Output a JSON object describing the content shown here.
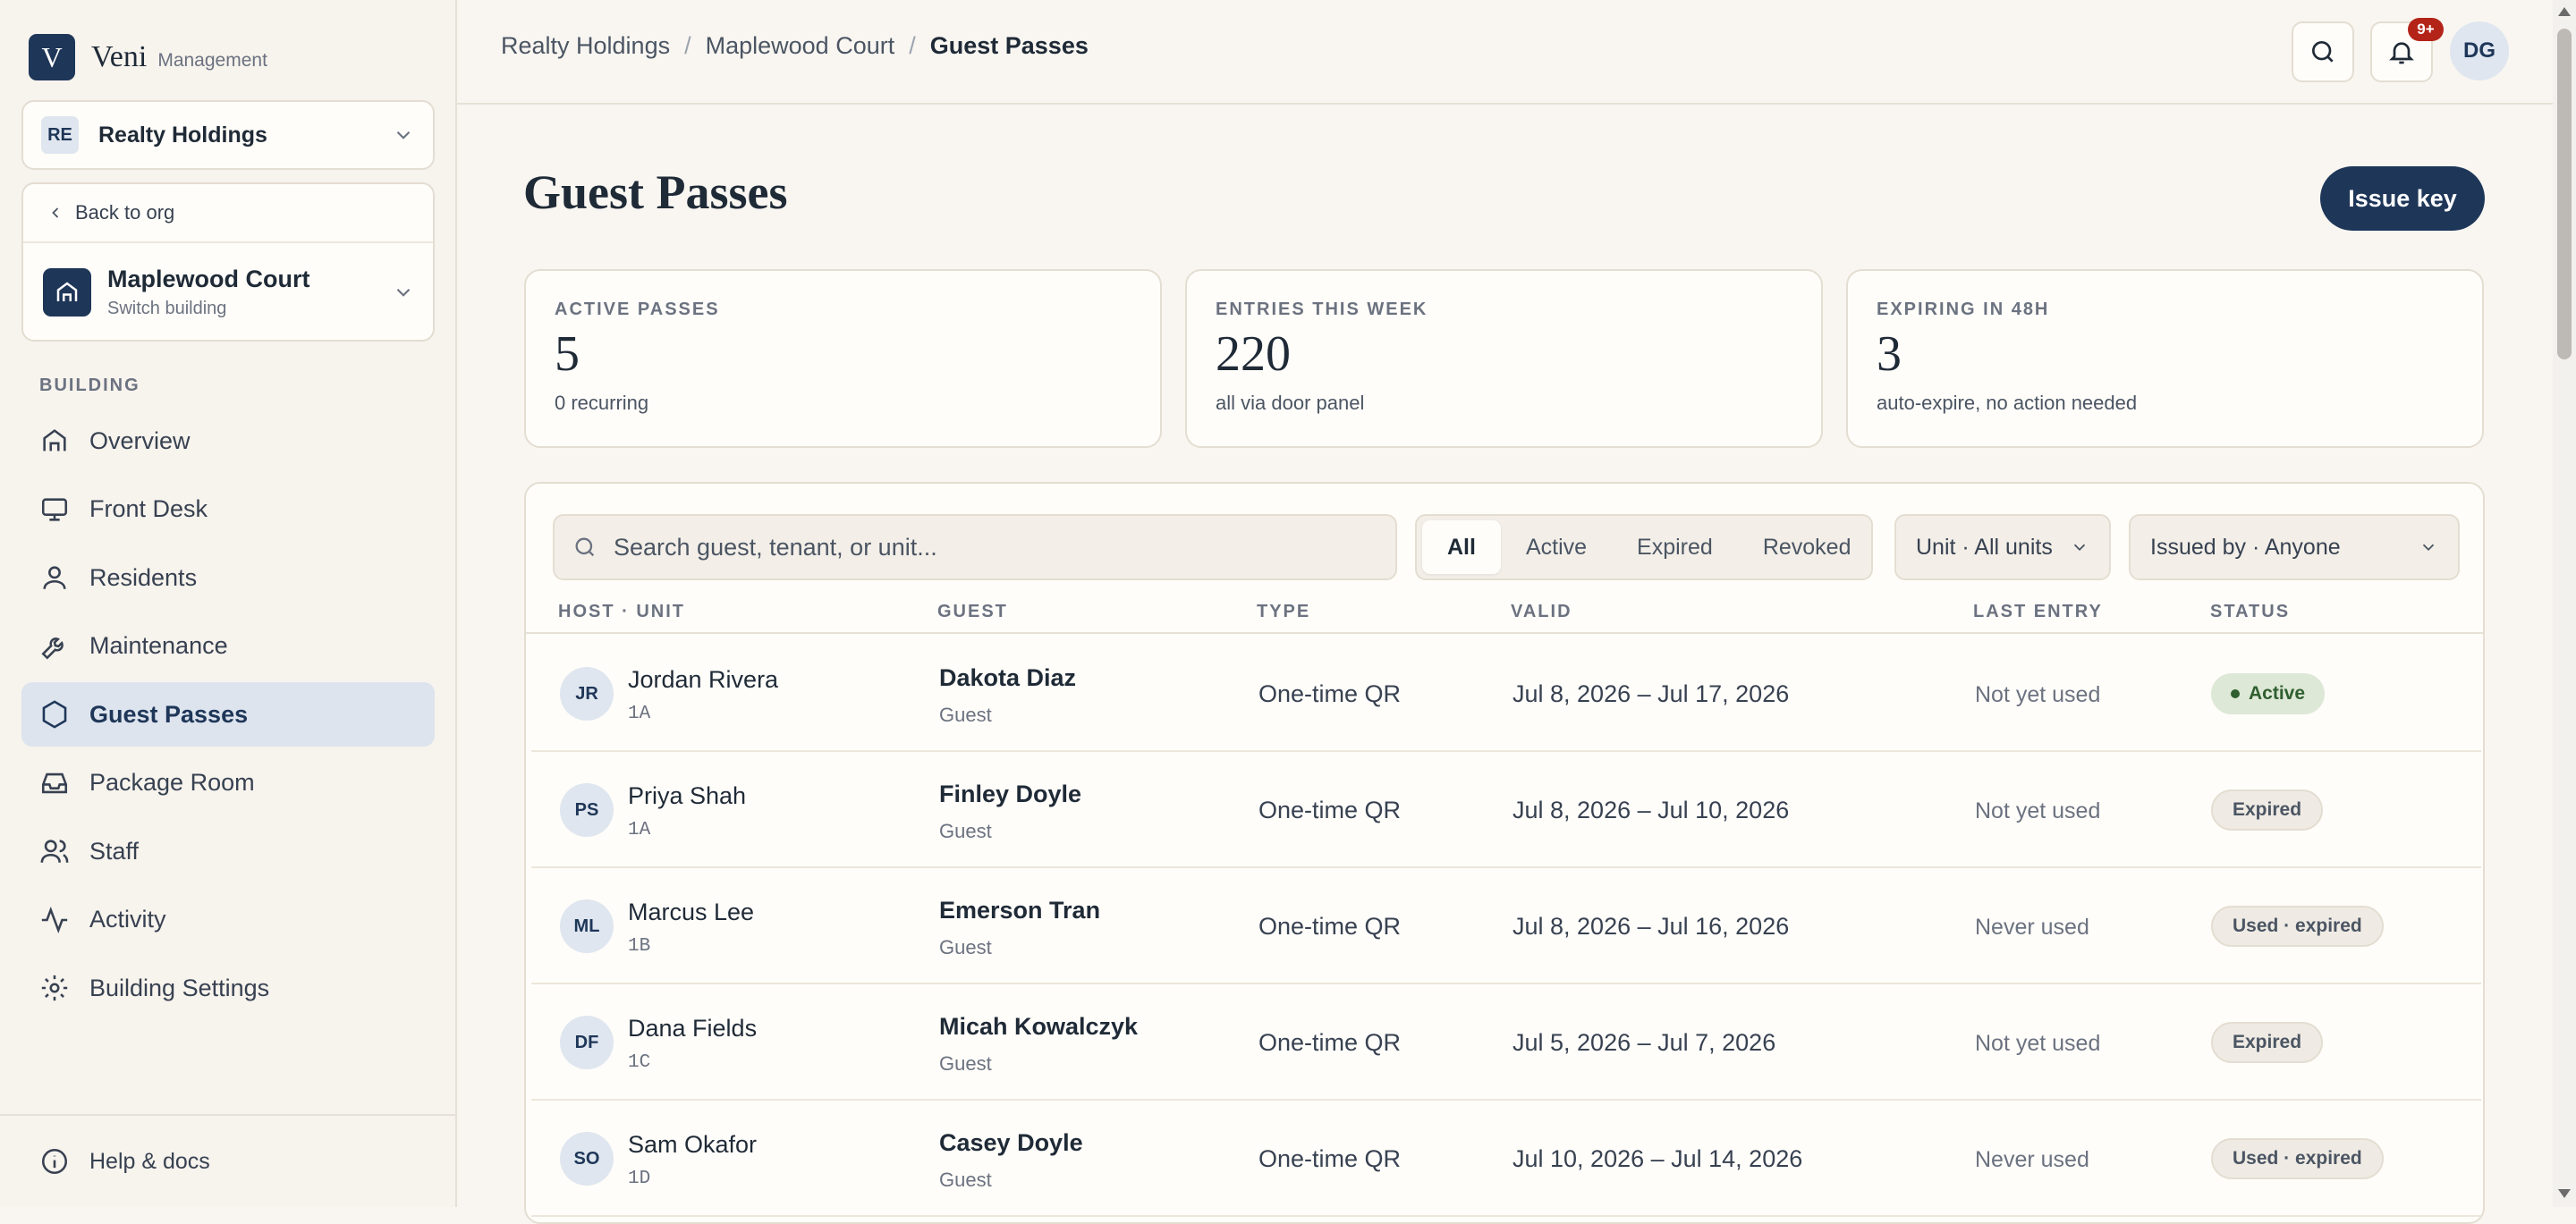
{
  "brand": {
    "logo_letter": "V",
    "name": "Veni",
    "sub": "Management"
  },
  "org": {
    "initials": "RE",
    "name": "Realty Holdings"
  },
  "building_card": {
    "back_label": "Back to org",
    "name": "Maplewood Court",
    "sub": "Switch building"
  },
  "nav": {
    "section": "BUILDING",
    "items": [
      {
        "label": "Overview",
        "icon": "home-icon"
      },
      {
        "label": "Front Desk",
        "icon": "monitor-icon"
      },
      {
        "label": "Residents",
        "icon": "user-icon"
      },
      {
        "label": "Maintenance",
        "icon": "wrench-icon"
      },
      {
        "label": "Guest Passes",
        "icon": "hexagon-icon",
        "active": true
      },
      {
        "label": "Package Room",
        "icon": "inbox-icon"
      },
      {
        "label": "Staff",
        "icon": "users-icon"
      },
      {
        "label": "Activity",
        "icon": "activity-icon"
      },
      {
        "label": "Building Settings",
        "icon": "gear-icon"
      }
    ],
    "help": "Help & docs"
  },
  "header": {
    "breadcrumbs": [
      "Realty Holdings",
      "Maplewood Court",
      "Guest Passes"
    ],
    "notif_count": "9+",
    "user_initials": "DG"
  },
  "page": {
    "title": "Guest Passes",
    "issue_button": "Issue key"
  },
  "stats": [
    {
      "label": "ACTIVE PASSES",
      "value": "5",
      "sub": "0 recurring"
    },
    {
      "label": "ENTRIES THIS WEEK",
      "value": "220",
      "sub": "all via door panel"
    },
    {
      "label": "EXPIRING IN 48H",
      "value": "3",
      "sub": "auto-expire, no action needed"
    }
  ],
  "filters": {
    "search_placeholder": "Search guest, tenant, or unit...",
    "segments": [
      "All",
      "Active",
      "Expired",
      "Revoked"
    ],
    "unit_dropdown": "Unit · All units",
    "issuer_dropdown": "Issued by · Anyone"
  },
  "table": {
    "columns": [
      "HOST · UNIT",
      "GUEST",
      "TYPE",
      "VALID",
      "LAST ENTRY",
      "STATUS"
    ],
    "rows": [
      {
        "initials": "JR",
        "host": "Jordan Rivera",
        "unit": "1A",
        "guest": "Dakota Diaz",
        "guest_role": "Guest",
        "type": "One-time QR",
        "valid": "Jul 8, 2026 – Jul 17, 2026",
        "last_entry": "Not yet used",
        "status": "Active",
        "status_kind": "active"
      },
      {
        "initials": "PS",
        "host": "Priya Shah",
        "unit": "1A",
        "guest": "Finley Doyle",
        "guest_role": "Guest",
        "type": "One-time QR",
        "valid": "Jul 8, 2026 – Jul 10, 2026",
        "last_entry": "Not yet used",
        "status": "Expired",
        "status_kind": "expired"
      },
      {
        "initials": "ML",
        "host": "Marcus Lee",
        "unit": "1B",
        "guest": "Emerson Tran",
        "guest_role": "Guest",
        "type": "One-time QR",
        "valid": "Jul 8, 2026 – Jul 16, 2026",
        "last_entry": "Never used",
        "status": "Used · expired",
        "status_kind": "used"
      },
      {
        "initials": "DF",
        "host": "Dana Fields",
        "unit": "1C",
        "guest": "Micah Kowalczyk",
        "guest_role": "Guest",
        "type": "One-time QR",
        "valid": "Jul 5, 2026 – Jul 7, 2026",
        "last_entry": "Not yet used",
        "status": "Expired",
        "status_kind": "expired"
      },
      {
        "initials": "SO",
        "host": "Sam Okafor",
        "unit": "1D",
        "guest": "Casey Doyle",
        "guest_role": "Guest",
        "type": "One-time QR",
        "valid": "Jul 10, 2026 – Jul 14, 2026",
        "last_entry": "Never used",
        "status": "Used · expired",
        "status_kind": "used"
      }
    ]
  },
  "colors": {
    "accent": "#1e3658",
    "background": "#f9f6f1",
    "active_status": "#dde8d6",
    "notif_badge": "#b42318"
  }
}
